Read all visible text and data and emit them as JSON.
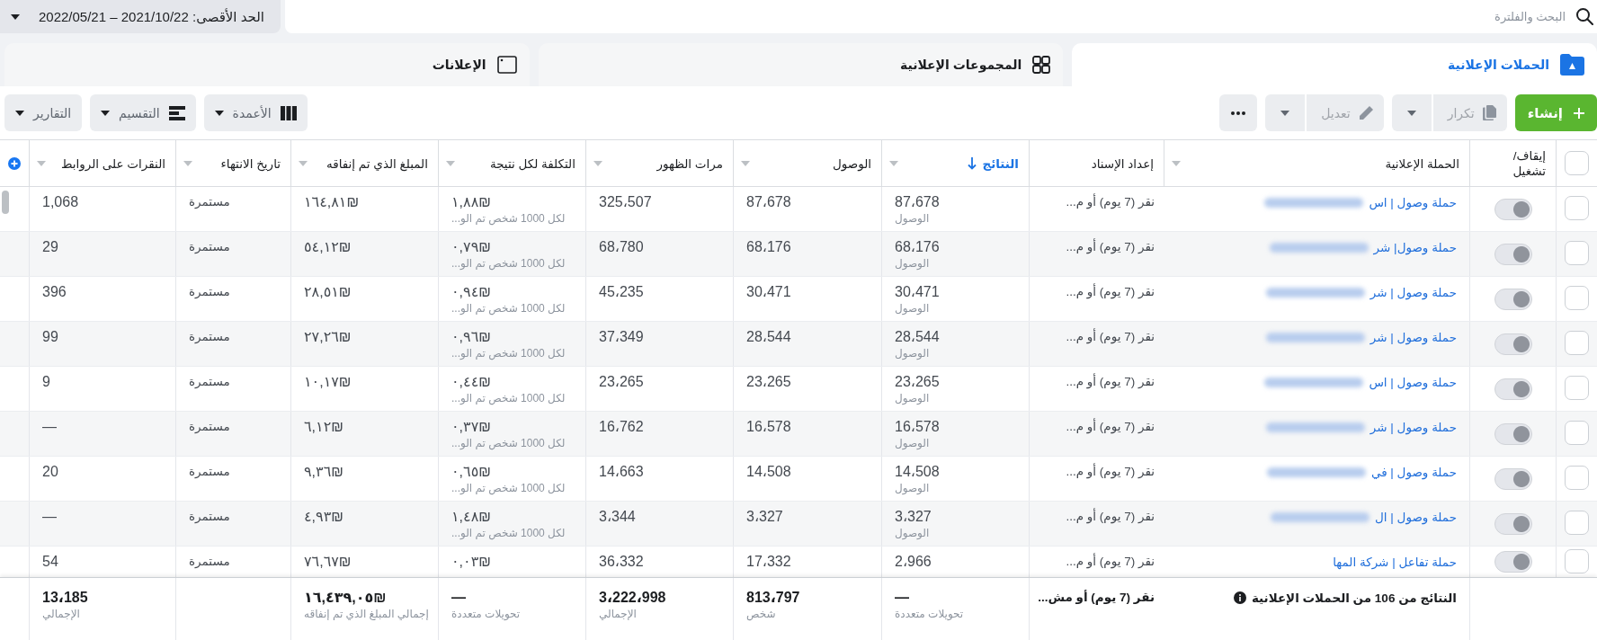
{
  "search": {
    "placeholder": "البحث والفلترة"
  },
  "date_range": {
    "label": "الحد الأقصى: 2021/10/22 – 2022/05/21"
  },
  "tabs": [
    {
      "kind": "campaigns",
      "label": "الحملات الإعلانية",
      "selected": true
    },
    {
      "kind": "adsets",
      "label": "المجموعات الإعلانية",
      "selected": false
    },
    {
      "kind": "ads",
      "label": "الإعلانات",
      "selected": false
    }
  ],
  "toolbar": {
    "actions": [
      {
        "kind": "create",
        "label": "إنشاء",
        "disabled": false
      },
      {
        "kind": "duplicate",
        "label": "تكرار",
        "disabled": true
      },
      {
        "kind": "edit",
        "label": "تعديل",
        "disabled": true
      },
      {
        "kind": "more",
        "disabled": false
      }
    ],
    "views": [
      {
        "kind": "columns",
        "label": "الأعمدة"
      },
      {
        "kind": "breakdown",
        "label": "التقسيم"
      },
      {
        "kind": "reports",
        "label": "التقارير"
      }
    ]
  },
  "table": {
    "select_all": {
      "checked": false
    },
    "columns": [
      {
        "label": "إيقاف/ تشغيل",
        "menu": false,
        "sorted": false
      },
      {
        "label": "الحملة الإعلانية",
        "menu": true,
        "sorted": false
      },
      {
        "label": "إعداد الإسناد",
        "menu": false,
        "sorted": false
      },
      {
        "label": "النتائج",
        "menu": true,
        "sorted": true
      },
      {
        "label": "الوصول",
        "menu": true,
        "sorted": false
      },
      {
        "label": "مرات الظهور",
        "menu": true,
        "sorted": false
      },
      {
        "label": "التكلفة لكل نتيجة",
        "menu": true,
        "sorted": false
      },
      {
        "label": "المبلغ الذي تم إنفاقه",
        "menu": true,
        "sorted": false
      },
      {
        "label": "تاريخ الانتهاء",
        "menu": true,
        "sorted": false
      },
      {
        "label": "النقرات على الروابط",
        "menu": true,
        "sorted": false
      }
    ],
    "rows": [
      {
        "checked": false,
        "on": false,
        "name": "حملة وصول | اس",
        "redacted": true,
        "attribution": "نقر (7 يوم) أو م...",
        "results": "87،678",
        "results_note": "الوصول",
        "reach": "87،678",
        "impressions": "325،507",
        "cost_per_result": "₪١,٨٨",
        "cost_per_result_note": "لكل 1000 شخص تم الو...",
        "amount_spent": "₪١٦٤,٨١",
        "end_date": "مستمرة",
        "link_clicks": "1,068"
      },
      {
        "checked": false,
        "on": false,
        "name": "حملة وصول| شر",
        "redacted": true,
        "attribution": "نقر (7 يوم) أو م...",
        "results": "68،176",
        "results_note": "الوصول",
        "reach": "68،176",
        "impressions": "68،780",
        "cost_per_result": "₪٠,٧٩",
        "cost_per_result_note": "لكل 1000 شخص تم الو...",
        "amount_spent": "₪٥٤,١٢",
        "end_date": "مستمرة",
        "link_clicks": "29"
      },
      {
        "checked": false,
        "on": false,
        "name": "حملة وصول | شر",
        "redacted": true,
        "attribution": "نقر (7 يوم) أو م...",
        "results": "30،471",
        "results_note": "الوصول",
        "reach": "30،471",
        "impressions": "45،235",
        "cost_per_result": "₪٠,٩٤",
        "cost_per_result_note": "لكل 1000 شخص تم الو...",
        "amount_spent": "₪٢٨,٥١",
        "end_date": "مستمرة",
        "link_clicks": "396"
      },
      {
        "checked": false,
        "on": false,
        "name": "حملة وصول | شر",
        "redacted": true,
        "attribution": "نقر (7 يوم) أو م...",
        "results": "28،544",
        "results_note": "الوصول",
        "reach": "28،544",
        "impressions": "37،349",
        "cost_per_result": "₪٠,٩٦",
        "cost_per_result_note": "لكل 1000 شخص تم الو...",
        "amount_spent": "₪٢٧,٢٦",
        "end_date": "مستمرة",
        "link_clicks": "99"
      },
      {
        "checked": false,
        "on": false,
        "name": "حملة وصول | اس",
        "redacted": true,
        "attribution": "نقر (7 يوم) أو م...",
        "results": "23،265",
        "results_note": "الوصول",
        "reach": "23،265",
        "impressions": "23،265",
        "cost_per_result": "₪٠,٤٤",
        "cost_per_result_note": "لكل 1000 شخص تم الو...",
        "amount_spent": "₪١٠,١٧",
        "end_date": "مستمرة",
        "link_clicks": "9"
      },
      {
        "checked": false,
        "on": false,
        "name": "حملة وصول | شر",
        "redacted": true,
        "attribution": "نقر (7 يوم) أو م...",
        "results": "16،578",
        "results_note": "الوصول",
        "reach": "16،578",
        "impressions": "16،762",
        "cost_per_result": "₪٠,٣٧",
        "cost_per_result_note": "لكل 1000 شخص تم الو...",
        "amount_spent": "₪٦,١٢",
        "end_date": "مستمرة",
        "link_clicks": "—"
      },
      {
        "checked": false,
        "on": false,
        "name": "حملة وصول | في",
        "redacted": true,
        "attribution": "نقر (7 يوم) أو م...",
        "results": "14،508",
        "results_note": "الوصول",
        "reach": "14،508",
        "impressions": "14،663",
        "cost_per_result": "₪٠,٦٥",
        "cost_per_result_note": "لكل 1000 شخص تم الو...",
        "amount_spent": "₪٩,٣٦",
        "end_date": "مستمرة",
        "link_clicks": "20"
      },
      {
        "checked": false,
        "on": false,
        "name": "حملة وصول | ال",
        "redacted": true,
        "attribution": "نقر (7 يوم) أو م...",
        "results": "3،327",
        "results_note": "الوصول",
        "reach": "3،327",
        "impressions": "3،344",
        "cost_per_result": "₪١,٤٨",
        "cost_per_result_note": "لكل 1000 شخص تم الو...",
        "amount_spent": "₪٤,٩٣",
        "end_date": "مستمرة",
        "link_clicks": "—"
      },
      {
        "checked": false,
        "on": false,
        "name": "حملة تفاعل | شركة المها",
        "redacted": false,
        "attribution": "نقر (7 يوم) أو م...",
        "results": "2،966",
        "reach": "17،332",
        "impressions": "36،332",
        "cost_per_result": "₪٠,٠٣",
        "amount_spent": "₪٧٦,٦٧",
        "end_date": "مستمرة",
        "link_clicks": "54"
      }
    ],
    "summary": {
      "label": "النتائج من 106 من الحملات الإعلانية",
      "attribution": "نقر (7 يوم) أو مش...",
      "results": "—",
      "results_note": "تحويلات متعددة",
      "reach": "813،797",
      "reach_note": "شخص",
      "impressions": "3،222،998",
      "impressions_note": "الإجمالي",
      "cost_per_result": "—",
      "cost_per_result_note": "تحويلات متعددة",
      "amount_spent": "₪١٦,٤٣٩,٠٥",
      "amount_spent_note": "إجمالي المبلغ الذي تم إنفاقه",
      "link_clicks": "13،185",
      "link_clicks_note": "الإجمالي"
    }
  }
}
